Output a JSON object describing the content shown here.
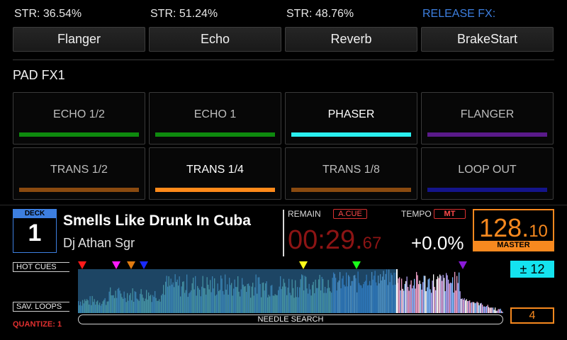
{
  "beat_fx": {
    "slots": [
      {
        "str": "STR: 36.54%",
        "button": "Flanger"
      },
      {
        "str": "STR: 51.24%",
        "button": "Echo"
      },
      {
        "str": "STR: 48.76%",
        "button": "Reverb"
      },
      {
        "str": "RELEASE FX:",
        "button": "BrakeStart"
      }
    ]
  },
  "pad_fx": {
    "title": "PAD FX1",
    "pads": [
      {
        "label": "ECHO 1/2",
        "color": "#0e8a0e"
      },
      {
        "label": "ECHO 1",
        "color": "#0e8a0e"
      },
      {
        "label": "PHASER",
        "color": "#2af0f0"
      },
      {
        "label": "FLANGER",
        "color": "#5a1a8a"
      },
      {
        "label": "TRANS 1/2",
        "color": "#8a4a10"
      },
      {
        "label": "TRANS 1/4",
        "color": "#ff8a1a"
      },
      {
        "label": "TRANS 1/8",
        "color": "#8a4a10"
      },
      {
        "label": "LOOP OUT",
        "color": "#14148a"
      }
    ]
  },
  "deck": {
    "label": "DECK",
    "number": "1",
    "track_title": "Smells Like Drunk In Cuba",
    "artist": "Dj Athan Sgr",
    "remain_label": "REMAIN",
    "auto_cue": "A.CUE",
    "time_main": "00:29.",
    "time_frac": "67",
    "tempo_label": "TEMPO",
    "master_tempo": "MT",
    "tempo": "+0.0%",
    "bpm_int": "128.",
    "bpm_dec": "10",
    "master": "MASTER",
    "hot_cues_label": "HOT CUES",
    "saved_loops_label": "SAV. LOOPS",
    "quantize": "QUANTIZE: 1",
    "needle_search": "NEEDLE SEARCH",
    "key_shift": "± 12",
    "loop_beats": "4",
    "play_position": 0.75,
    "hot_cues": [
      {
        "pos": 0.01,
        "color": "#ff1a1a"
      },
      {
        "pos": 0.09,
        "color": "#ff1aff"
      },
      {
        "pos": 0.125,
        "color": "#e07a10"
      },
      {
        "pos": 0.155,
        "color": "#1a2aff"
      },
      {
        "pos": 0.53,
        "color": "#ffff1a"
      },
      {
        "pos": 0.655,
        "color": "#1aff1a"
      },
      {
        "pos": 0.905,
        "color": "#8a1ad8"
      }
    ]
  }
}
